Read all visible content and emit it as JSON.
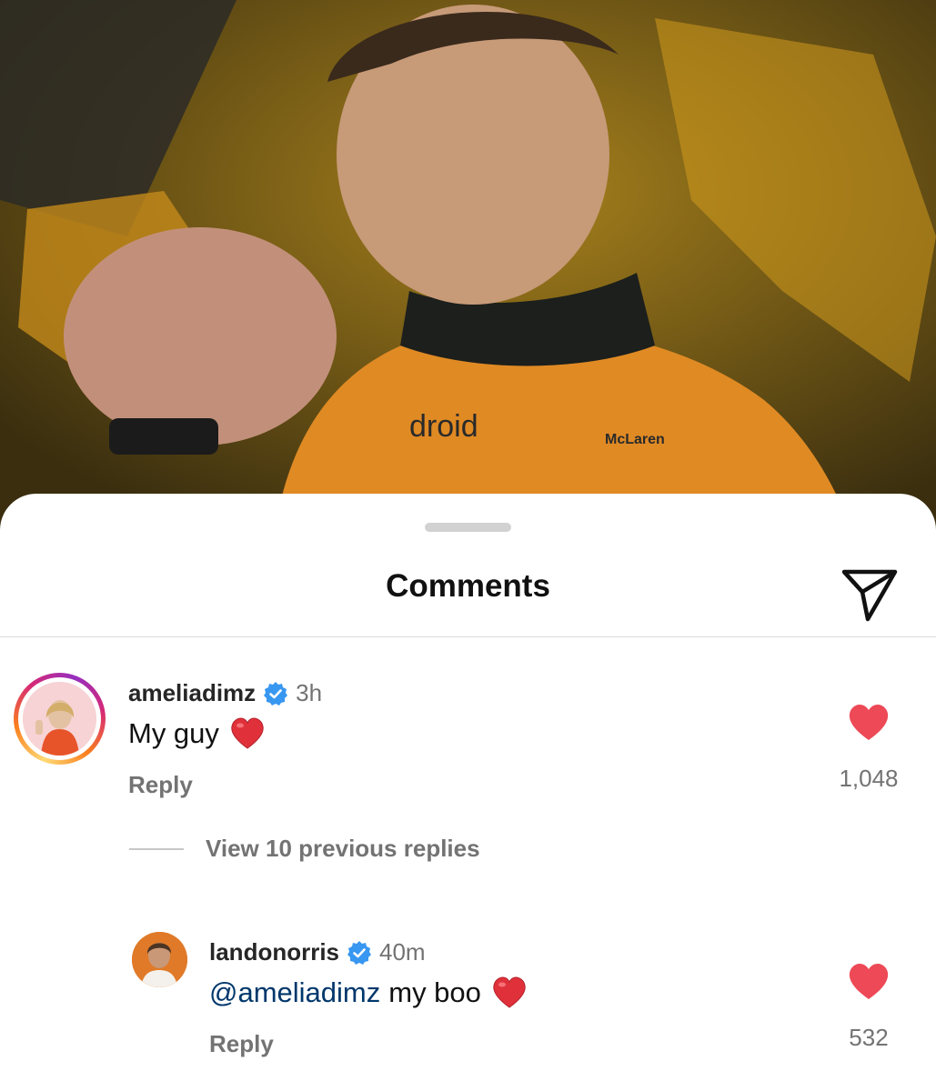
{
  "sheet": {
    "title": "Comments"
  },
  "comments": [
    {
      "username": "ameliadimz",
      "time": "3h",
      "text": "My guy",
      "reply_label": "Reply",
      "likes": "1,048",
      "liked": true,
      "verified": true,
      "has_story_ring": true
    },
    {
      "username": "landonorris",
      "time": "40m",
      "mention": "@ameliadimz",
      "text": "my boo",
      "reply_label": "Reply",
      "likes": "532",
      "liked": true,
      "verified": true
    }
  ],
  "thread": {
    "view_replies_label": "View 10 previous replies"
  },
  "colors": {
    "like": "#ed4956",
    "verified": "#3897f0",
    "mention": "#00376b",
    "muted": "#737373"
  },
  "icons": {
    "share": "paper-plane-icon",
    "like": "heart-icon",
    "verified": "verified-badge-icon"
  }
}
